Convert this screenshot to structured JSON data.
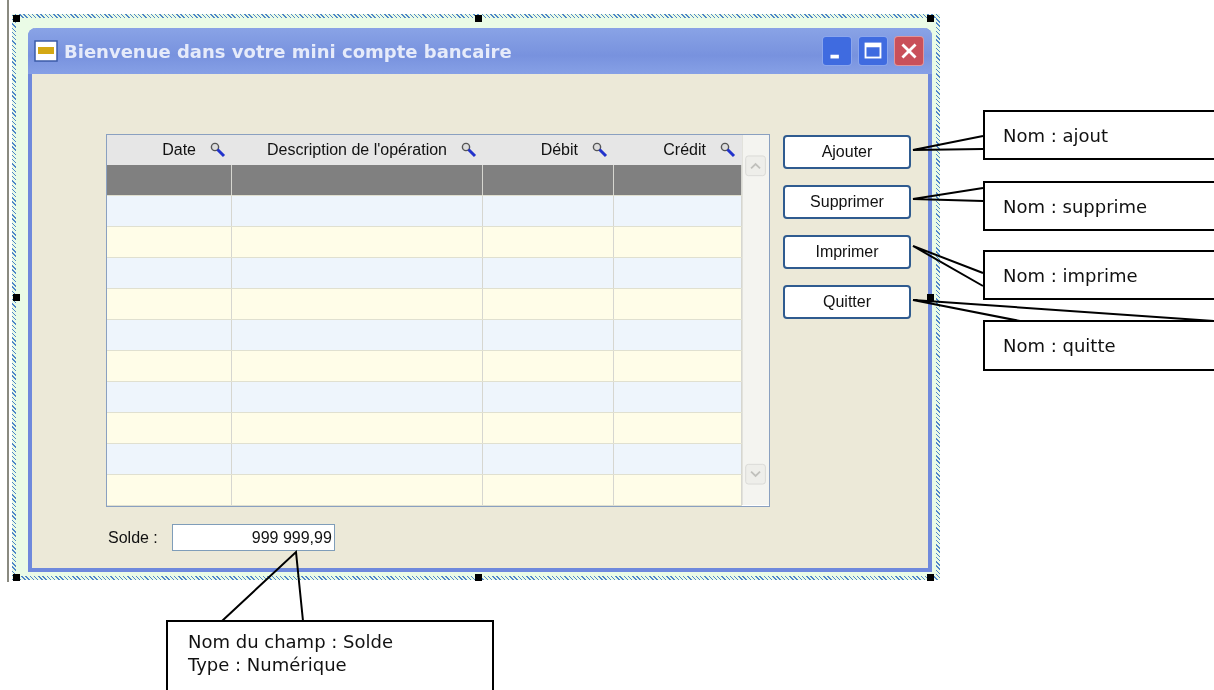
{
  "window": {
    "title": "Bienvenue dans votre mini compte bancaire"
  },
  "table": {
    "columns": [
      {
        "label": "Date"
      },
      {
        "label": "Description de l'opération"
      },
      {
        "label": "Débit"
      },
      {
        "label": "Crédit"
      }
    ],
    "rows": [
      {
        "selected": true
      },
      {
        "selected": false
      },
      {
        "selected": false
      },
      {
        "selected": false
      },
      {
        "selected": false
      },
      {
        "selected": false
      },
      {
        "selected": false
      },
      {
        "selected": false
      },
      {
        "selected": false
      },
      {
        "selected": false
      },
      {
        "selected": false
      }
    ]
  },
  "buttons": [
    {
      "label": "Ajouter"
    },
    {
      "label": "Supprimer"
    },
    {
      "label": "Imprimer"
    },
    {
      "label": "Quitter"
    }
  ],
  "balance": {
    "label": "Solde :",
    "value": "999 999,99"
  },
  "button_callouts": [
    {
      "text": "Nom : ajout"
    },
    {
      "text": "Nom : supprime"
    },
    {
      "text": "Nom : imprime"
    },
    {
      "text": "Nom : quitte"
    }
  ],
  "field_callout": {
    "lines": [
      "Nom du champ : Solde",
      "Type : Numérique"
    ]
  }
}
